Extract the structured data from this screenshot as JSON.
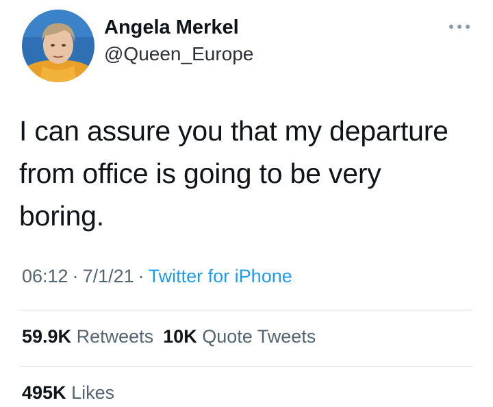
{
  "author": {
    "display_name": "Angela Merkel",
    "handle": "@Queen_Europe"
  },
  "tweet": {
    "lines": [
      "I can assure you that my departure",
      "from office is going to be very",
      "boring."
    ]
  },
  "meta": {
    "time": "06:12",
    "separator": "·",
    "date": "7/1/21",
    "source": "Twitter for iPhone"
  },
  "stats": {
    "retweets_count": "59.9K",
    "retweets_label": "Retweets",
    "quotes_count": "10K",
    "quotes_label": "Quote Tweets",
    "likes_count": "495K",
    "likes_label": "Likes"
  },
  "icons": {
    "more": "more-horizontal-icon"
  },
  "colors": {
    "text": "#0f1419",
    "secondary": "#536471",
    "link": "#1d9bf0",
    "divider": "#d9dde1"
  }
}
